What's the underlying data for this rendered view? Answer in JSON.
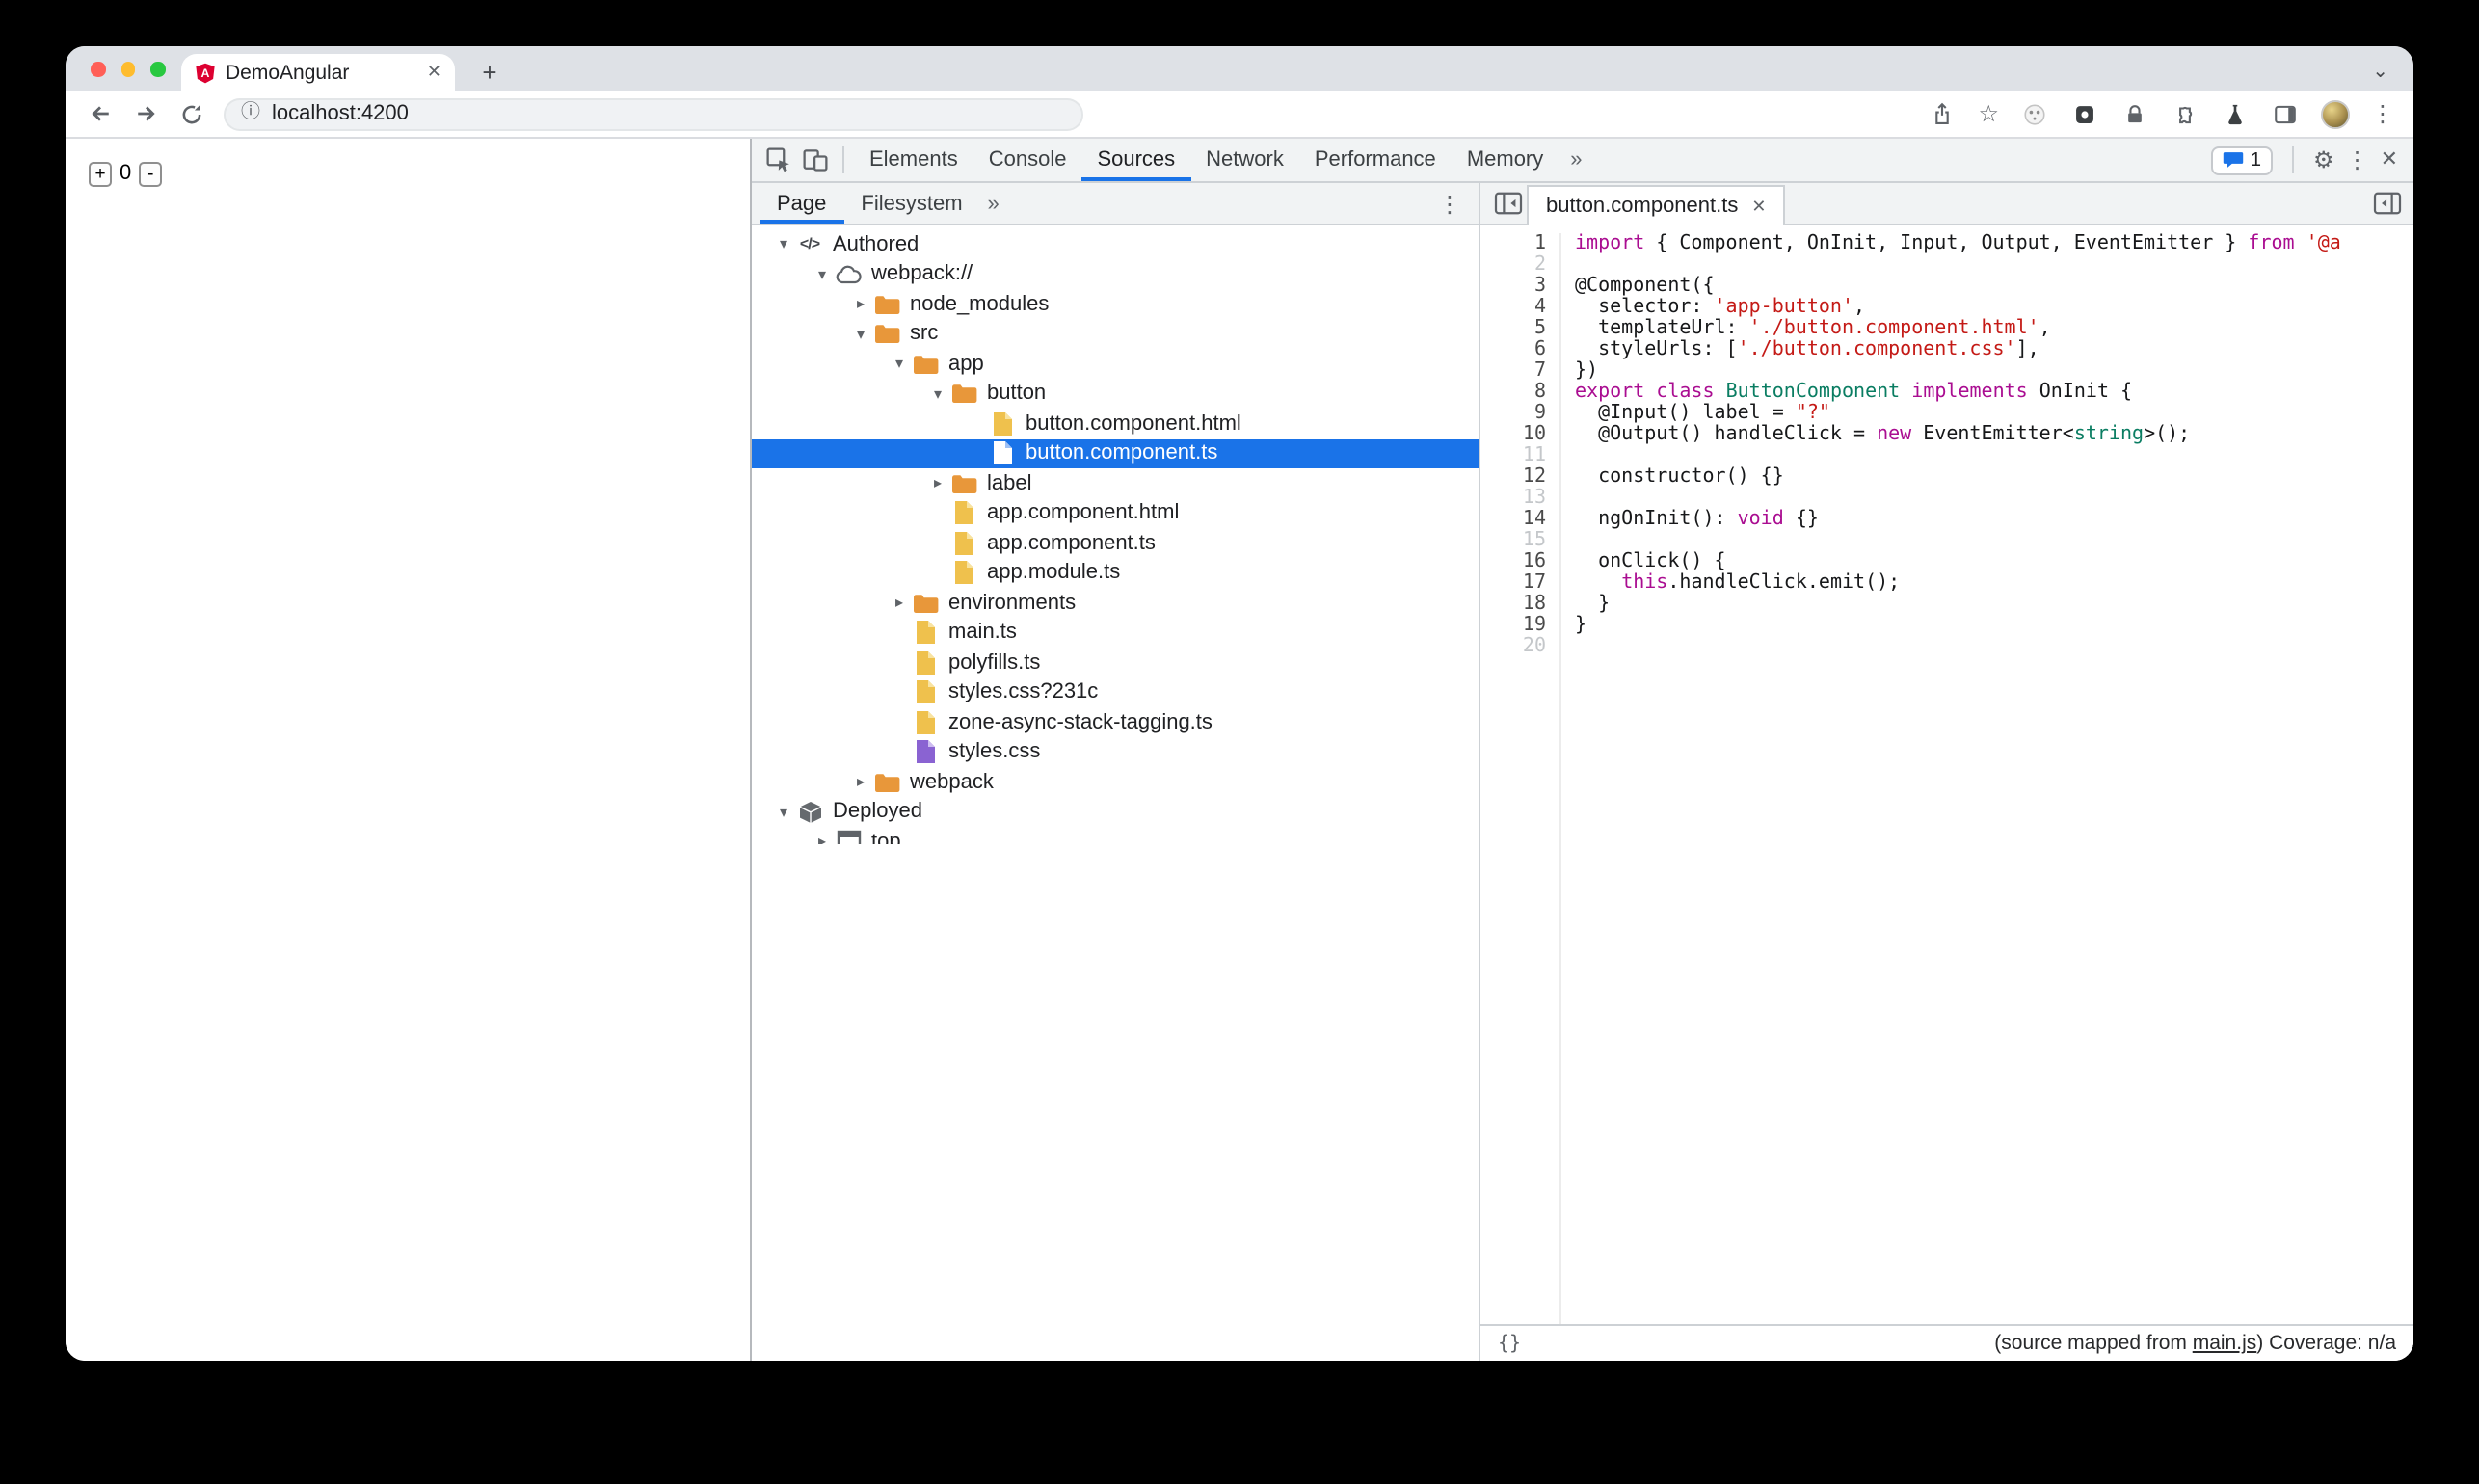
{
  "browser": {
    "tab_title": "DemoAngular",
    "url": "localhost:4200"
  },
  "page": {
    "increment_label": "+",
    "count": "0",
    "decrement_label": "-"
  },
  "devtools": {
    "tabs": [
      {
        "label": "Elements"
      },
      {
        "label": "Console"
      },
      {
        "label": "Sources",
        "selected": true
      },
      {
        "label": "Network"
      },
      {
        "label": "Performance"
      },
      {
        "label": "Memory"
      }
    ],
    "message_count": "1",
    "sidebar_tabs": [
      {
        "label": "Page",
        "selected": true
      },
      {
        "label": "Filesystem"
      }
    ],
    "tree": {
      "items": [
        {
          "depth": 0,
          "arrow": "down",
          "icon": "code-icon",
          "label": "Authored"
        },
        {
          "depth": 1,
          "arrow": "down",
          "icon": "cloud-icon",
          "label": "webpack://"
        },
        {
          "depth": 2,
          "arrow": "right",
          "icon": "folder-icon",
          "label": "node_modules"
        },
        {
          "depth": 2,
          "arrow": "down",
          "icon": "folder-icon",
          "label": "src"
        },
        {
          "depth": 3,
          "arrow": "down",
          "icon": "folder-icon",
          "label": "app"
        },
        {
          "depth": 4,
          "arrow": "down",
          "icon": "folder-icon",
          "label": "button"
        },
        {
          "depth": 5,
          "arrow": "none",
          "icon": "file-icon",
          "label": "button.component.html"
        },
        {
          "depth": 5,
          "arrow": "none",
          "icon": "file-icon",
          "label": "button.component.ts",
          "selected": true
        },
        {
          "depth": 4,
          "arrow": "right",
          "icon": "folder-icon",
          "label": "label"
        },
        {
          "depth": 4,
          "arrow": "none",
          "icon": "file-icon",
          "label": "app.component.html"
        },
        {
          "depth": 4,
          "arrow": "none",
          "icon": "file-icon",
          "label": "app.component.ts"
        },
        {
          "depth": 4,
          "arrow": "none",
          "icon": "file-icon",
          "label": "app.module.ts"
        },
        {
          "depth": 3,
          "arrow": "right",
          "icon": "folder-icon",
          "label": "environments"
        },
        {
          "depth": 3,
          "arrow": "none",
          "icon": "file-icon",
          "label": "main.ts"
        },
        {
          "depth": 3,
          "arrow": "none",
          "icon": "file-icon",
          "label": "polyfills.ts"
        },
        {
          "depth": 3,
          "arrow": "none",
          "icon": "file-icon",
          "label": "styles.css?231c"
        },
        {
          "depth": 3,
          "arrow": "none",
          "icon": "file-icon",
          "label": "zone-async-stack-tagging.ts"
        },
        {
          "depth": 3,
          "arrow": "none",
          "icon": "css-file-icon",
          "label": "styles.css"
        },
        {
          "depth": 2,
          "arrow": "right",
          "icon": "folder-icon",
          "label": "webpack"
        },
        {
          "depth": 0,
          "arrow": "down",
          "icon": "package-icon",
          "label": "Deployed"
        },
        {
          "depth": 1,
          "arrow": "right",
          "icon": "frame-icon",
          "label": "top"
        }
      ]
    },
    "editor": {
      "tab_title": "button.component.ts",
      "lines": [
        [
          [
            "kw",
            "import"
          ],
          [
            "pln",
            " { Component, OnInit, Input, Output, EventEmitter } "
          ],
          [
            "kw",
            "from"
          ],
          [
            "pln",
            " "
          ],
          [
            "str",
            "'@a"
          ]
        ],
        [],
        [
          [
            "pln",
            "@Component({"
          ]
        ],
        [
          [
            "pln",
            "  selector: "
          ],
          [
            "str",
            "'app-button'"
          ],
          [
            "pln",
            ","
          ]
        ],
        [
          [
            "pln",
            "  templateUrl: "
          ],
          [
            "str",
            "'./button.component.html'"
          ],
          [
            "pln",
            ","
          ]
        ],
        [
          [
            "pln",
            "  styleUrls: ["
          ],
          [
            "str",
            "'./button.component.css'"
          ],
          [
            "pln",
            "],"
          ]
        ],
        [
          [
            "pln",
            "})"
          ]
        ],
        [
          [
            "kw",
            "export"
          ],
          [
            "pln",
            " "
          ],
          [
            "kw",
            "class"
          ],
          [
            "pln",
            " "
          ],
          [
            "typ",
            "ButtonComponent"
          ],
          [
            "pln",
            " "
          ],
          [
            "kw",
            "implements"
          ],
          [
            "pln",
            " OnInit {"
          ]
        ],
        [
          [
            "pln",
            "  @Input() label = "
          ],
          [
            "str",
            "\"?\""
          ]
        ],
        [
          [
            "pln",
            "  @Output() handleClick = "
          ],
          [
            "kw",
            "new"
          ],
          [
            "pln",
            " EventEmitter<"
          ],
          [
            "typ",
            "string"
          ],
          [
            "pln",
            ">();"
          ]
        ],
        [],
        [
          [
            "pln",
            "  constructor() {}"
          ]
        ],
        [],
        [
          [
            "pln",
            "  ngOnInit(): "
          ],
          [
            "kw",
            "void"
          ],
          [
            "pln",
            " {}"
          ]
        ],
        [],
        [
          [
            "pln",
            "  onClick() {"
          ]
        ],
        [
          [
            "pln",
            "    "
          ],
          [
            "kw",
            "this"
          ],
          [
            "pln",
            ".handleClick.emit();"
          ]
        ],
        [
          [
            "pln",
            "  }"
          ]
        ],
        [
          [
            "pln",
            "}"
          ]
        ],
        []
      ]
    },
    "status": {
      "format_label": "{}",
      "mapped_prefix": "(source mapped from ",
      "mapped_link": "main.js",
      "mapped_suffix": ") Coverage: n/a"
    }
  },
  "icons": {
    "close": "✕",
    "kebab": "⋮",
    "plus": "+",
    "chevron_down": "⌄",
    "star": "☆",
    "info": "ⓘ",
    "gear": "⚙",
    "more": "»",
    "triangle_down": "▾",
    "triangle_right": "▸"
  },
  "colors": {
    "accent_blue": "#1a73e8",
    "selection_blue": "#1a73e8",
    "keyword": "#aa0d91",
    "string": "#c41a16",
    "type": "#0a7d62",
    "folder": "#e8973a",
    "file_yellow": "#efc14d",
    "file_purple": "#8a63d2",
    "angular_red": "#dd0031"
  }
}
